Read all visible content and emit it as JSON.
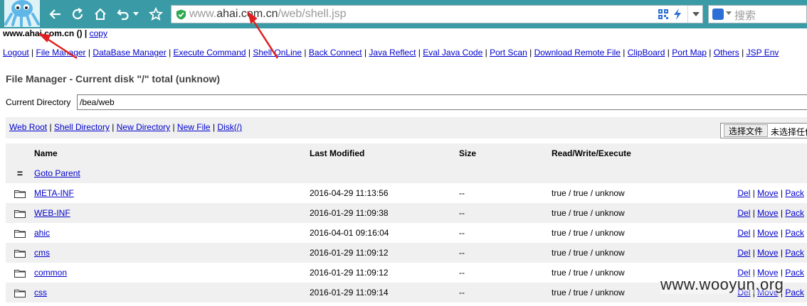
{
  "browser": {
    "url_host": "www.ahai.com.cn",
    "url_path": "/web/shell.jsp",
    "search_placeholder": "搜索",
    "accent_color": "#3a9ba6"
  },
  "page": {
    "host_line": "www.ahai.com.cn ()",
    "host_sep": " | ",
    "copy_label": "copy",
    "menu": [
      "Logout",
      "File Manager",
      "DataBase Manager",
      "Execute Command",
      "Shell OnLine",
      "Back Connect",
      "Java Reflect",
      "Eval Java Code",
      "Port Scan",
      "Download Remote File",
      "ClipBoard",
      "Port Map",
      "Others",
      "JSP Env"
    ],
    "title": "File Manager - Current disk \"/\" total (unknow)",
    "current_dir_label": "Current Directory",
    "current_dir_value": "/bea/web",
    "action_links": [
      "Web Root",
      "Shell Directory",
      "New Directory",
      "New File",
      "Disk(/)"
    ],
    "file_button": "选择文件",
    "file_none": "未选择任何文件"
  },
  "table": {
    "headers": {
      "name": "Name",
      "modified": "Last Modified",
      "size": "Size",
      "rwx": "Read/Write/Execute"
    },
    "parent_icon": "=",
    "parent_label": "Goto Parent",
    "rows": [
      {
        "name": "META-INF",
        "modified": "2016-04-29 11:13:56",
        "size": "--",
        "rwx": "true / true / unknow"
      },
      {
        "name": "WEB-INF",
        "modified": "2016-01-29 11:09:38",
        "size": "--",
        "rwx": "true / true / unknow"
      },
      {
        "name": "ahic",
        "modified": "2016-04-01 09:16:04",
        "size": "--",
        "rwx": "true / true / unknow"
      },
      {
        "name": "cms",
        "modified": "2016-01-29 11:09:12",
        "size": "--",
        "rwx": "true / true / unknow"
      },
      {
        "name": "common",
        "modified": "2016-01-29 11:09:12",
        "size": "--",
        "rwx": "true / true / unknow"
      },
      {
        "name": "css",
        "modified": "2016-01-29 11:09:14",
        "size": "--",
        "rwx": "true / true / unknow"
      }
    ],
    "row_actions": [
      "Del",
      "Move",
      "Pack"
    ]
  },
  "watermark": "www.wooyun.org"
}
